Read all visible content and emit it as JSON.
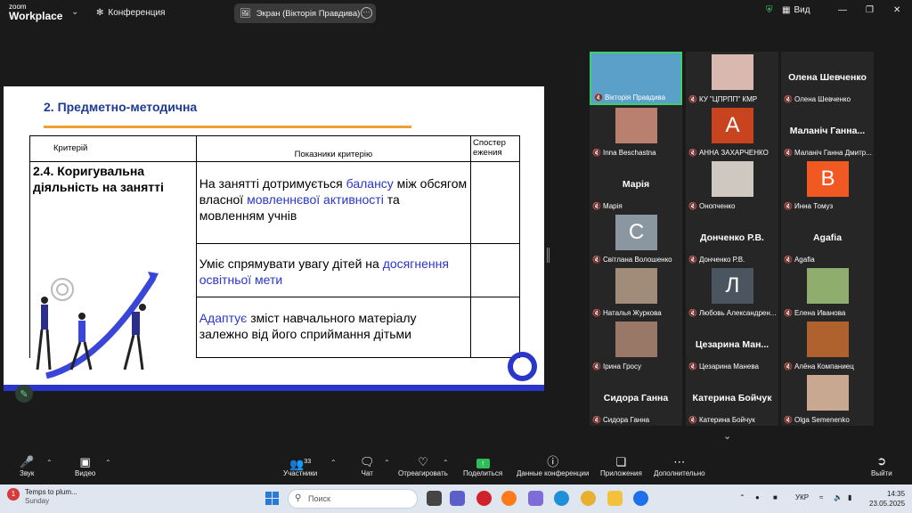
{
  "titlebar": {
    "logo_small": "zoom",
    "logo_big": "Workplace",
    "conference": "Конференция",
    "share_label": "Экран (Вікторія Правдива)",
    "view_label": "Вид"
  },
  "slide": {
    "title": "2. Предметно-методична",
    "col_criterion": "Критерій",
    "col_indicators": "Показники критерію",
    "col_observation": "Спостер ежения",
    "criterion": "2.4. Коригувальна діяльність на занятті",
    "row1": {
      "a": "На занятті дотримується ",
      "b": "балансу",
      "c": " між обсягом власної ",
      "d": "мовленнєвої активності",
      "e": " та мовленням учнів"
    },
    "row2": {
      "a": "Уміє спрямувати увагу дітей на ",
      "b": "досягнення освітньої мети"
    },
    "row3": {
      "a": "Адаптує",
      "b": " зміст навчального матеріалу залежно від його сприймання дітьми"
    }
  },
  "gallery": [
    {
      "label": "Вікторія Правдива",
      "name": "",
      "avatar": "photo",
      "color": "#5aa0c8",
      "active": true
    },
    {
      "label": "КУ \"ЦПРПП\" КМР",
      "name": "",
      "avatar": "photo",
      "color": "#d9b8b0"
    },
    {
      "label": "Олена Шевченко",
      "name": "Олена Шевченко",
      "avatar": "none"
    },
    {
      "label": "Inna Beschastna",
      "name": "",
      "avatar": "photo",
      "color": "#b98070"
    },
    {
      "label": "АННА ЗАХАРЧЕНКО",
      "name": "",
      "avatar": "letter",
      "letter": "A",
      "color": "#c8441f"
    },
    {
      "label": "Маланіч Ганна Дмитр...",
      "name": "Маланіч Ганна...",
      "avatar": "none"
    },
    {
      "label": "Марія",
      "name": "Марія",
      "avatar": "none"
    },
    {
      "label": "Онопченко",
      "name": "",
      "avatar": "photo",
      "color": "#cfc8c0"
    },
    {
      "label": "Инна Томуз",
      "name": "",
      "avatar": "letter",
      "letter": "B",
      "color": "#f05a22"
    },
    {
      "label": "Світлана Волошенко",
      "name": "",
      "avatar": "letter",
      "letter": "C",
      "color": "#8a96a0"
    },
    {
      "label": "Донченко Р.В.",
      "name": "Донченко Р.В.",
      "avatar": "none"
    },
    {
      "label": "Agafia",
      "name": "Agafia",
      "avatar": "none"
    },
    {
      "label": "Наталья Журкова",
      "name": "",
      "avatar": "photo",
      "color": "#a08c78"
    },
    {
      "label": "Любовь Александрен...",
      "name": "",
      "avatar": "letter",
      "letter": "Л",
      "color": "#4a5560"
    },
    {
      "label": "Елена Иванова",
      "name": "",
      "avatar": "photo",
      "color": "#8fae6e"
    },
    {
      "label": "Ірина Гросу",
      "name": "",
      "avatar": "photo",
      "color": "#9a7868"
    },
    {
      "label": "Цезарина Манева",
      "name": "Цезарина Ман...",
      "avatar": "none"
    },
    {
      "label": "Алёна Компаниец",
      "name": "",
      "avatar": "photo",
      "color": "#b0622e"
    },
    {
      "label": "Сидора Ганна",
      "name": "Сидора Ганна",
      "avatar": "none"
    },
    {
      "label": "Катерина Бойчук",
      "name": "Катерина Бойчук",
      "avatar": "none"
    },
    {
      "label": "Olga Semenenko",
      "name": "",
      "avatar": "photo",
      "color": "#c8a890"
    }
  ],
  "toolbar": {
    "audio": "Звук",
    "video": "Видео",
    "participants": "Участники",
    "participants_count": "33",
    "chat": "Чат",
    "react": "Отреагировать",
    "share": "Поделиться",
    "info": "Данные конференции",
    "apps": "Приложения",
    "more": "Дополнительно",
    "leave": "Выйти"
  },
  "taskbar": {
    "weather_title": "Temps to plum...",
    "weather_sub": "Sunday",
    "weather_badge": "1",
    "search_placeholder": "Поиск",
    "lang": "УКР",
    "time": "14:35",
    "date": "23.05.2025"
  }
}
